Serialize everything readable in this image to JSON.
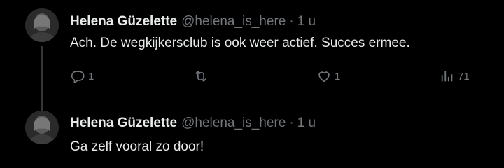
{
  "tweets": [
    {
      "author_name": "Helena Güzelette",
      "author_handle": "@helena_is_here",
      "separator": "·",
      "time": "1 u",
      "text": "Ach. De wegkijkersclub is ook weer actief. Succes ermee.",
      "reply_count": "1",
      "retweet_count": "",
      "like_count": "1",
      "view_count": "71"
    },
    {
      "author_name": "Helena Güzelette",
      "author_handle": "@helena_is_here",
      "separator": "·",
      "time": "1 u",
      "text": "Ga zelf vooral zo door!"
    }
  ],
  "icons": {
    "reply": "reply-icon",
    "retweet": "retweet-icon",
    "like": "heart-icon",
    "views": "views-chart-icon"
  },
  "colors": {
    "background": "#000000",
    "primary_text": "#e7e9ea",
    "secondary_text": "#71767b",
    "thread_line": "#333639"
  }
}
